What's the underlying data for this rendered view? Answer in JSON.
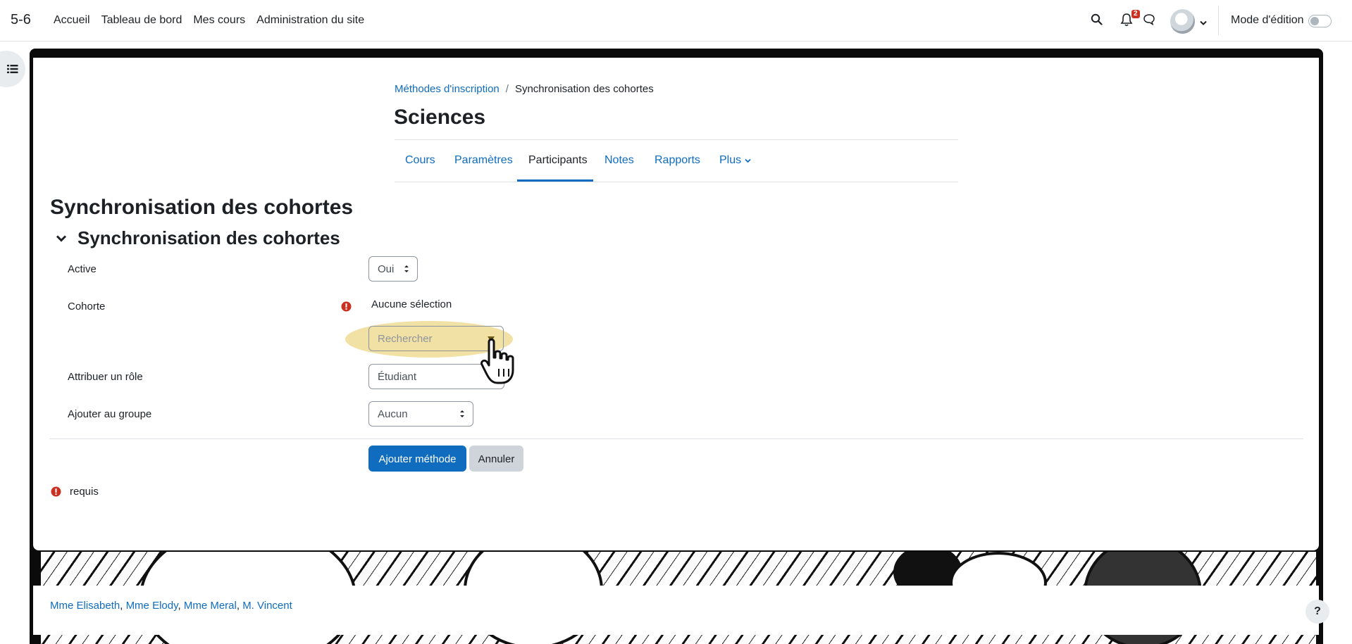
{
  "navbar": {
    "brand": "5-6",
    "links": [
      "Accueil",
      "Tableau de bord",
      "Mes cours",
      "Administration du site"
    ],
    "notification_count": "2",
    "edit_mode_label": "Mode d'édition",
    "edit_mode_on": false
  },
  "breadcrumb": {
    "link": "Méthodes d'inscription",
    "separator": "/",
    "current": "Synchronisation des cohortes"
  },
  "course": {
    "title": "Sciences",
    "tabs": [
      "Cours",
      "Paramètres",
      "Participants",
      "Notes",
      "Rapports",
      "Plus"
    ],
    "active_tab": "Participants"
  },
  "page": {
    "heading": "Synchronisation des cohortes",
    "section_heading": "Synchronisation des cohortes"
  },
  "form": {
    "active": {
      "label": "Active",
      "value": "Oui"
    },
    "cohort": {
      "label": "Cohorte",
      "selection": "Aucune sélection",
      "search_placeholder": "Rechercher"
    },
    "role": {
      "label": "Attribuer un rôle",
      "value": "Étudiant"
    },
    "group": {
      "label": "Ajouter au groupe",
      "value": "Aucun"
    },
    "submit_label": "Ajouter méthode",
    "cancel_label": "Annuler",
    "required_note": "requis"
  },
  "footer": {
    "teachers": [
      "Mme Elisabeth",
      "Mme Elody",
      "Mme Meral",
      "M. Vincent"
    ],
    "help_label": "?"
  },
  "colors": {
    "link": "#0f6cbf",
    "primary_button": "#0f6cbf",
    "error": "#ca3120",
    "highlight": "#e8c95a"
  }
}
